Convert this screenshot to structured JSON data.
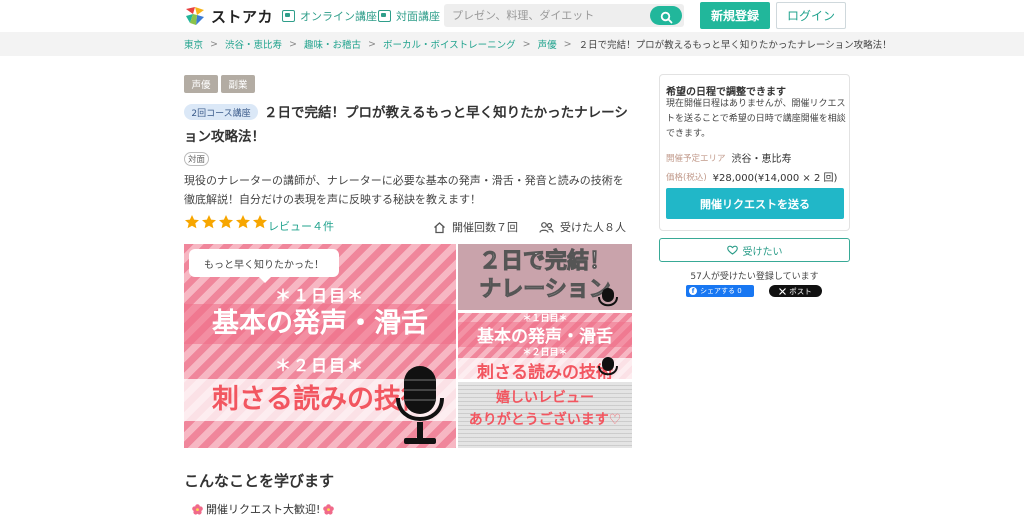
{
  "header": {
    "logo_text": "ストアカ",
    "nav": [
      {
        "label": "オンライン講座",
        "icon": "monitor-icon"
      },
      {
        "label": "対面講座",
        "icon": "classroom-icon"
      }
    ],
    "search_placeholder": "プレゼン、料理、ダイエット",
    "signup_label": "新規登録",
    "login_label": "ログイン"
  },
  "breadcrumb": {
    "items": [
      "東京",
      "渋谷・恵比寿",
      "趣味・お稽古",
      "ボーカル・ボイストレーニング",
      "声優"
    ],
    "separator": ">",
    "current": "２日で完結！プロが教えるもっと早く知りたかったナレーション攻略法！"
  },
  "course": {
    "tags": [
      "声優",
      "副業"
    ],
    "course_badge": "2回コース講座",
    "title": "２日で完結！プロが教えるもっと早く知りたかったナレーション攻略法！",
    "format_badge": "対面",
    "description": "現役のナレーターの講師が、ナレーターに必要な基本の発声・滑舌・発音と読みの技術を徹底解説！自分だけの表現を声に反映する秘訣を教えます！",
    "rating": 5,
    "reviews_label": "レビュー４件",
    "held_count_label": "開催回数７回",
    "attendees_label": "受けた人８人"
  },
  "gallery": {
    "main": {
      "banner": "もっと早く知りたかった！",
      "day1": "＊１日目＊",
      "line1": "基本の発声・滑舌",
      "day2": "＊２日目＊",
      "line2": "刺さる読みの技術"
    },
    "thumb1": {
      "line1": "２日で完結！",
      "line2": "ナレーション"
    },
    "thumb2": {
      "day": "＊１日目＊",
      "line1": "基本の発声・滑舌",
      "day2": "＊２日目＊",
      "line2": "刺さる読みの技術"
    },
    "thumb3": {
      "line1": "嬉しいレビュー",
      "line2": "ありがとうございます♡"
    }
  },
  "sections": {
    "learn_heading": "こんなことを学びます",
    "promo": "開催リクエスト大歓迎!"
  },
  "sidebar": {
    "heading": "希望の日程で調整できます",
    "text": "現在開催日程はありませんが、開催リクエストを送ることで希望の日時で講座開催を相談できます。",
    "area_label": "開催予定エリア",
    "area_value": "渋谷・恵比寿",
    "price_label": "価格(税込)",
    "price_value": "¥28,000(¥14,000 × 2 回)",
    "request_button": "開催リクエストを送る",
    "want_button": "受けたい",
    "want_count": "57人が受けたい登録しています",
    "fb_share": "シェアする 0",
    "x_post": "ポスト"
  },
  "colors": {
    "brand": "#21b79b",
    "request": "#21b7c8",
    "star": "#f7a600",
    "pink": "#f0869b"
  }
}
